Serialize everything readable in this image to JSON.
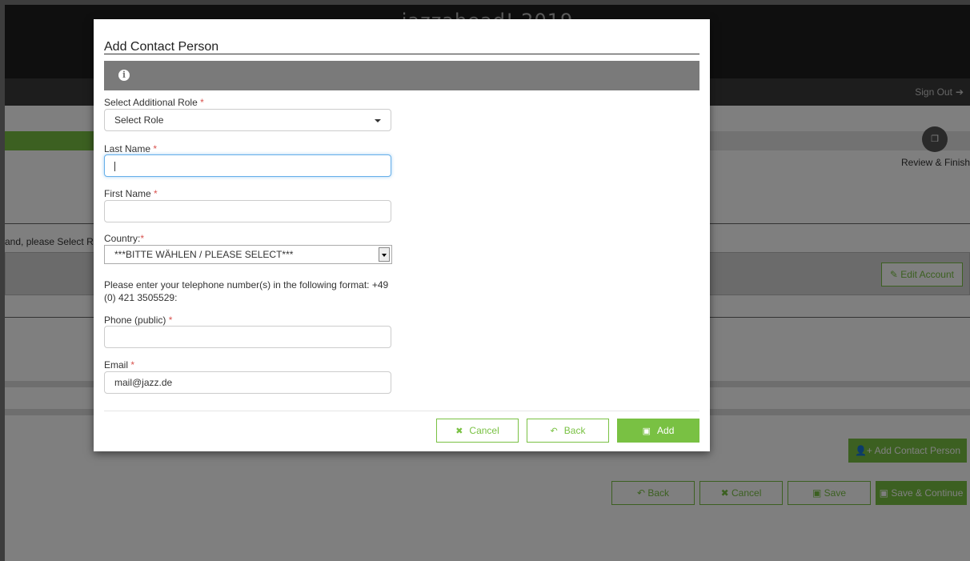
{
  "background": {
    "site_title": "jazzahead! 2019",
    "sign_out_label": "Sign Out",
    "step_label": "Review & Finish",
    "instruction_fragment": "and, please Select Rol",
    "edit_account_label": "Edit Account",
    "add_contact_person_label": "Add Contact Person",
    "buttons": {
      "back": "Back",
      "cancel": "Cancel",
      "save": "Save",
      "save_continue": "Save & Continue"
    }
  },
  "modal": {
    "title": "Add Contact Person",
    "role": {
      "label": "Select Additional Role",
      "value": "Select Role"
    },
    "last_name": {
      "label": "Last Name",
      "value": ""
    },
    "first_name": {
      "label": "First Name",
      "value": ""
    },
    "country": {
      "label": "Country:",
      "value": "***BITTE WÄHLEN / PLEASE SELECT***"
    },
    "phone_help": "Please enter your telephone number(s) in the following format: +49 (0) 421 3505529:",
    "phone": {
      "label": "Phone (public)",
      "value": ""
    },
    "email": {
      "label": "Email",
      "value": "mail@jazz.de"
    },
    "buttons": {
      "cancel": "Cancel",
      "back": "Back",
      "add": "Add"
    }
  },
  "colors": {
    "accent": "#79c143",
    "required": "#d9534f",
    "info_bar": "#7a7a7a"
  },
  "icons": [
    "info-icon",
    "sign-out-icon",
    "copy-icon",
    "pencil-icon",
    "add-user-icon",
    "reply-icon",
    "times-icon",
    "save-icon",
    "caret-down-icon"
  ]
}
